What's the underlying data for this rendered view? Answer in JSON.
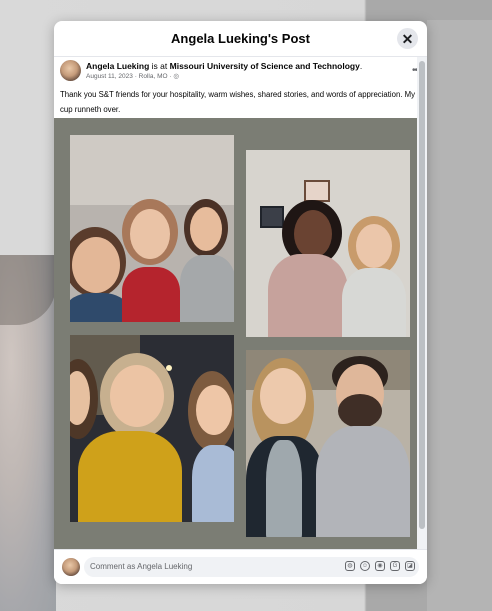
{
  "modal": {
    "title": "Angela Lueking's Post",
    "close_icon": "close-icon"
  },
  "post": {
    "author": "Angela Lueking",
    "is_at": "is at",
    "place": "Missouri University of Science and Technology",
    "period": ".",
    "date": "August 11, 2023",
    "location": "Rolla, MO",
    "separator": "·",
    "audience_icon": "globe-icon",
    "more_icon": "more-options-icon",
    "text": "Thank you S&T friends for your hospitality, warm wishes, shared stories, and words of appreciation. My cup runneth over."
  },
  "photos": [
    {
      "id": "photo-1"
    },
    {
      "id": "photo-2"
    },
    {
      "id": "photo-3"
    },
    {
      "id": "photo-4"
    }
  ],
  "comment": {
    "placeholder": "Comment as Angela Lueking",
    "icons": [
      "avatar-icon",
      "emoji-icon",
      "camera-icon",
      "gif-icon",
      "sticker-icon"
    ]
  },
  "colors": {
    "photo_background": "#7b7d74",
    "overlay": "#d3d3d3"
  }
}
